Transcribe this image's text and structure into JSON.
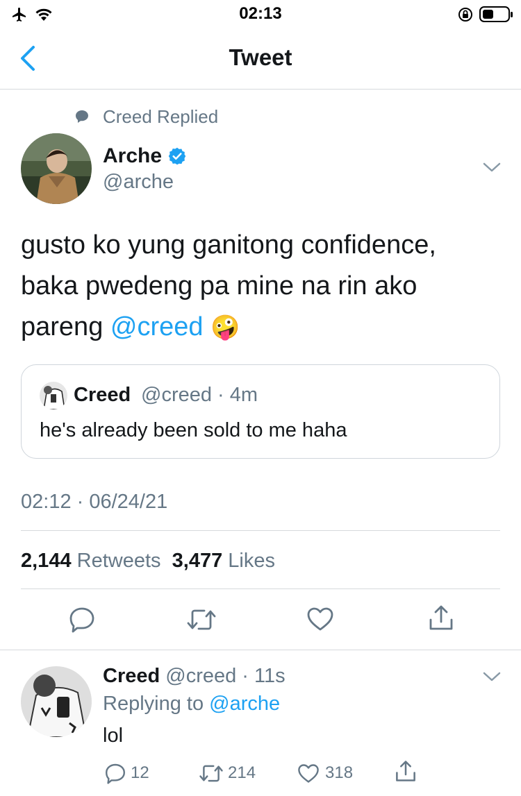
{
  "status_bar": {
    "time": "02:13"
  },
  "header": {
    "title": "Tweet"
  },
  "context": {
    "label": "Creed Replied"
  },
  "tweet": {
    "author_name": "Arche",
    "author_handle": "@arche",
    "text_line1": "gusto ko yung ganitong confidence,",
    "text_line2": "baka pwedeng pa mine na rin ako",
    "text_line3_prefix": "pareng ",
    "mention": "@creed",
    "emoji": "🤪",
    "timestamp": "02:12 · 06/24/21",
    "retweets_count": "2,144",
    "retweets_label": "Retweets",
    "likes_count": "3,477",
    "likes_label": "Likes"
  },
  "quoted_tweet": {
    "name": "Creed",
    "handle_time": "@creed · 4m",
    "text": "he's already been sold to me haha"
  },
  "reply": {
    "name": "Creed",
    "handle_time": "@creed · 11s",
    "replying_prefix": "Replying to",
    "replying_to": "@arche",
    "text": "lol",
    "replies": "12",
    "retweets": "214",
    "likes": "318"
  },
  "colors": {
    "accent": "#1da1f2",
    "text": "#14171a",
    "secondary": "#657786",
    "divider": "#d6d9dc"
  }
}
